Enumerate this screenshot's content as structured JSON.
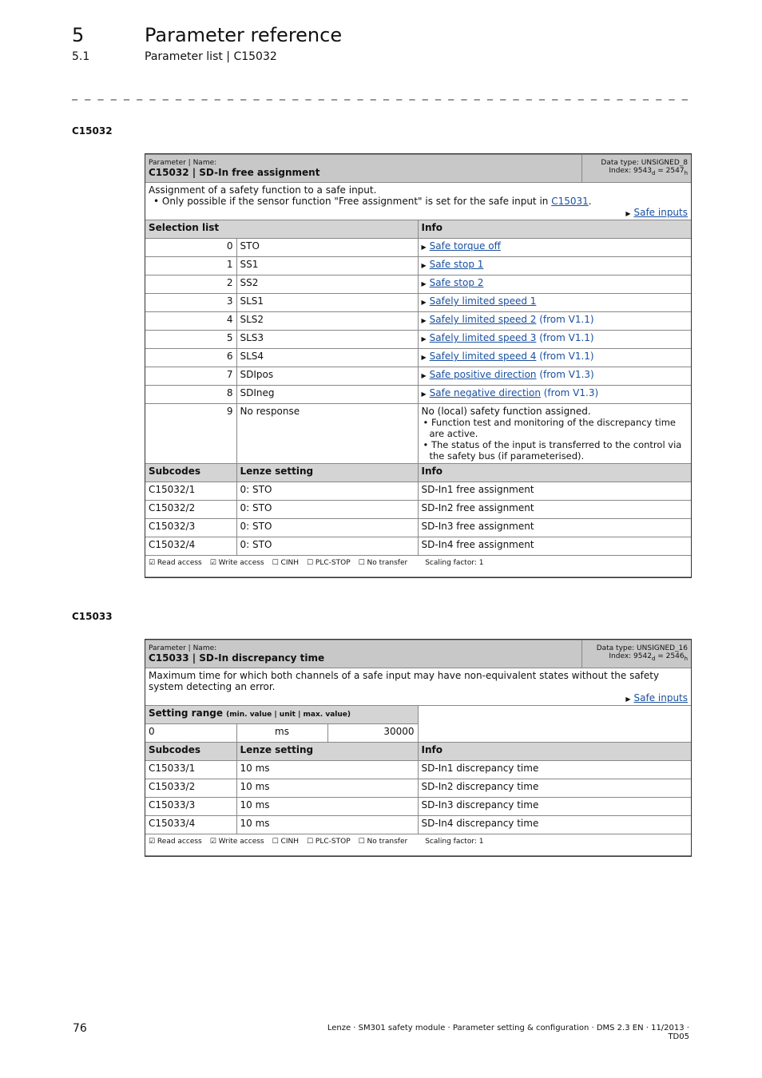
{
  "header": {
    "chapter": "5",
    "chapter_title": "Parameter reference",
    "section": "5.1",
    "section_title": "Parameter list | C15032"
  },
  "p1": {
    "heading": "C15032",
    "param_label": "Parameter | Name:",
    "name": "C15032 | SD-In free assignment",
    "data_type": "Data type: UNSIGNED_8",
    "index_pre": "Index: 9543",
    "index_d": "d",
    "index_mid": " = 2547",
    "index_h": "h",
    "desc": "Assignment of a safety function to a safe input.",
    "bullet_pre": "• Only possible if the sensor function \"Free assignment\" is set for the safe input in ",
    "bullet_link": "C15031",
    "bullet_post": ".",
    "see_link": "Safe inputs",
    "sel_header": "Selection list",
    "info_header": "Info",
    "rows": [
      {
        "n": "0",
        "v": "STO",
        "link": "Safe torque off",
        "extra": ""
      },
      {
        "n": "1",
        "v": "SS1",
        "link": "Safe stop 1",
        "extra": ""
      },
      {
        "n": "2",
        "v": "SS2",
        "link": "Safe stop 2",
        "extra": ""
      },
      {
        "n": "3",
        "v": "SLS1",
        "link": "Safely limited speed 1",
        "extra": ""
      },
      {
        "n": "4",
        "v": "SLS2",
        "link": "Safely limited speed 2",
        "extra": " (from V1.1)"
      },
      {
        "n": "5",
        "v": "SLS3",
        "link": "Safely limited speed 3",
        "extra": " (from V1.1)"
      },
      {
        "n": "6",
        "v": "SLS4",
        "link": "Safely limited speed 4",
        "extra": " (from V1.1)"
      },
      {
        "n": "7",
        "v": "SDIpos",
        "link": "Safe positive direction",
        "extra": " (from V1.3)"
      },
      {
        "n": "8",
        "v": "SDIneg",
        "link": "Safe negative direction",
        "extra": " (from V1.3)"
      }
    ],
    "row9": {
      "n": "9",
      "v": "No response",
      "info": "No (local) safety function assigned.",
      "b1": "• Function test and monitoring of the discrepancy time are active.",
      "b2": "• The status of the input is transferred to the control via the safety bus (if parameterised)."
    },
    "sub_headers": [
      "Subcodes",
      "Lenze setting",
      "Info"
    ],
    "subs": [
      [
        "C15032/1",
        "0: STO",
        "SD-In1 free assignment"
      ],
      [
        "C15032/2",
        "0: STO",
        "SD-In2 free assignment"
      ],
      [
        "C15032/3",
        "0: STO",
        "SD-In3 free assignment"
      ],
      [
        "C15032/4",
        "0: STO",
        "SD-In4 free assignment"
      ]
    ],
    "footer": [
      "☑ Read access",
      "☑ Write access",
      "☐ CINH",
      "☐ PLC-STOP",
      "☐ No transfer",
      "Scaling factor: 1"
    ]
  },
  "p2": {
    "heading": "C15033",
    "param_label": "Parameter | Name:",
    "name": "C15033 | SD-In discrepancy time",
    "data_type": "Data type: UNSIGNED_16",
    "index_pre": "Index: 9542",
    "index_d": "d",
    "index_mid": " = 2546",
    "index_h": "h",
    "desc": "Maximum time for which both channels of a safe input may have non-equivalent states without the safety system detecting an error.",
    "see_link": "Safe inputs",
    "range_label": "Setting range",
    "range_sub": "(min. value | unit | max. value)",
    "min": "0",
    "unit": "ms",
    "max": "30000",
    "sub_headers": [
      "Subcodes",
      "Lenze setting",
      "Info"
    ],
    "subs": [
      [
        "C15033/1",
        "10 ms",
        "SD-In1 discrepancy time"
      ],
      [
        "C15033/2",
        "10 ms",
        "SD-In2 discrepancy time"
      ],
      [
        "C15033/3",
        "10 ms",
        "SD-In3 discrepancy time"
      ],
      [
        "C15033/4",
        "10 ms",
        "SD-In4 discrepancy time"
      ]
    ],
    "footer": [
      "☑ Read access",
      "☑ Write access",
      "☐ CINH",
      "☐ PLC-STOP",
      "☐ No transfer",
      "Scaling factor: 1"
    ]
  },
  "page_footer": {
    "page": "76",
    "text": "Lenze · SM301 safety module · Parameter setting & configuration · DMS 2.3 EN · 11/2013 · TD05"
  }
}
